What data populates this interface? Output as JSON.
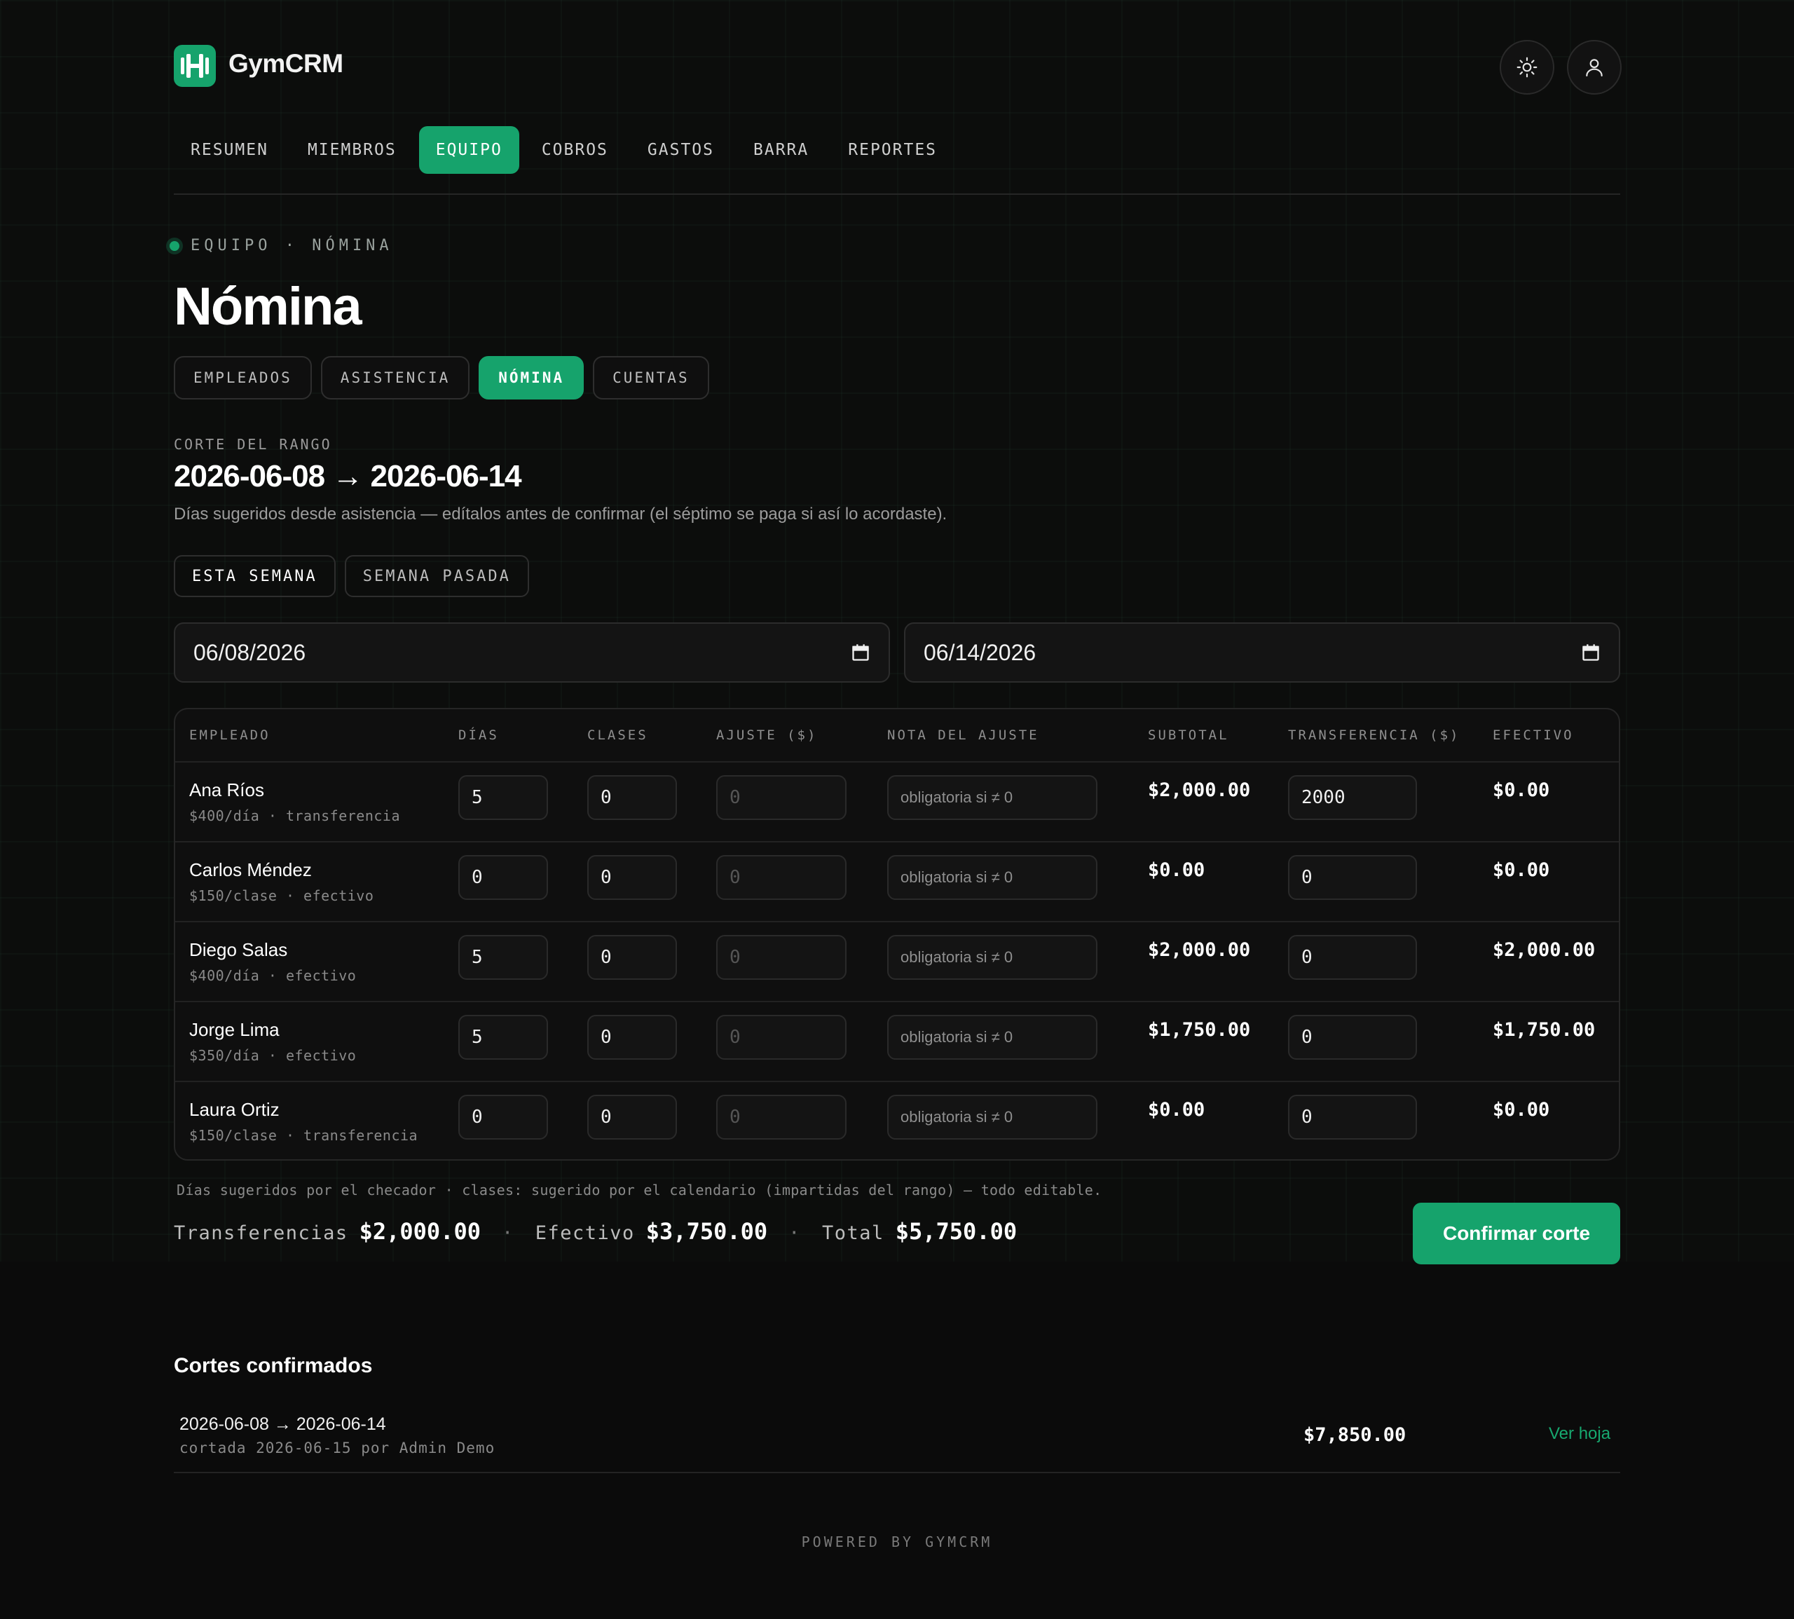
{
  "header": {
    "app_name": "GymCRM",
    "theme_icon": "sun-icon",
    "user_icon": "user-icon"
  },
  "nav": [
    "RESUMEN",
    "MIEMBROS",
    "EQUIPO",
    "COBROS",
    "GASTOS",
    "BARRA",
    "REPORTES"
  ],
  "nav_active": "EQUIPO",
  "breadcrumb": "EQUIPO · NÓMINA",
  "page_title": "Nómina",
  "subtabs": [
    "EMPLEADOS",
    "ASISTENCIA",
    "NÓMINA",
    "CUENTAS"
  ],
  "subtab_active": "NÓMINA",
  "range": {
    "label": "CORTE DEL RANGO",
    "text": "2026-06-08 → 2026-06-14",
    "hint": "Días sugeridos desde asistencia — edítalos antes de confirmar (el séptimo se paga si así lo acordaste)."
  },
  "quick_ranges": [
    "ESTA SEMANA",
    "SEMANA PASADA"
  ],
  "dates": {
    "from": "06/08/2026",
    "to": "06/14/2026"
  },
  "table": {
    "headers": [
      "EMPLEADO",
      "DÍAS",
      "CLASES",
      "AJUSTE ($)",
      "NOTA DEL AJUSTE",
      "SUBTOTAL",
      "TRANSFERENCIA ($)",
      "EFECTIVO"
    ],
    "note_placeholder": "obligatoria si ≠ 0",
    "rows": [
      {
        "name": "Ana Ríos",
        "sub": "$400/día · transferencia",
        "dias": "5",
        "clases": "0",
        "ajuste": "0",
        "subtotal": "$2,000.00",
        "transferencia": "2000",
        "efectivo": "$0.00"
      },
      {
        "name": "Carlos Méndez",
        "sub": "$150/clase · efectivo",
        "dias": "0",
        "clases": "0",
        "ajuste": "0",
        "subtotal": "$0.00",
        "transferencia": "0",
        "efectivo": "$0.00"
      },
      {
        "name": "Diego Salas",
        "sub": "$400/día · efectivo",
        "dias": "5",
        "clases": "0",
        "ajuste": "0",
        "subtotal": "$2,000.00",
        "transferencia": "0",
        "efectivo": "$2,000.00"
      },
      {
        "name": "Jorge Lima",
        "sub": "$350/día · efectivo",
        "dias": "5",
        "clases": "0",
        "ajuste": "0",
        "subtotal": "$1,750.00",
        "transferencia": "0",
        "efectivo": "$1,750.00"
      },
      {
        "name": "Laura Ortiz",
        "sub": "$150/clase · transferencia",
        "dias": "0",
        "clases": "0",
        "ajuste": "0",
        "subtotal": "$0.00",
        "transferencia": "0",
        "efectivo": "$0.00"
      }
    ]
  },
  "footnote": "Días sugeridos por el checador · clases: sugerido por el calendario (impartidas del rango) — todo editable.",
  "totals": {
    "transfer_label": "Transferencias",
    "transfer_value": "$2,000.00",
    "cash_label": "Efectivo",
    "cash_value": "$3,750.00",
    "total_label": "Total",
    "total_value": "$5,750.00",
    "separator": "·"
  },
  "confirm_label": "Confirmar corte",
  "cortes": {
    "title": "Cortes confirmados",
    "items": [
      {
        "range": "2026-06-08 → 2026-06-14",
        "sub": "cortada 2026-06-15 por Admin Demo",
        "amount": "$7,850.00",
        "link": "Ver hoja"
      }
    ]
  },
  "footer": "POWERED BY GYMCRM",
  "colors": {
    "accent": "#16a36c",
    "background": "#0b0b0b"
  }
}
